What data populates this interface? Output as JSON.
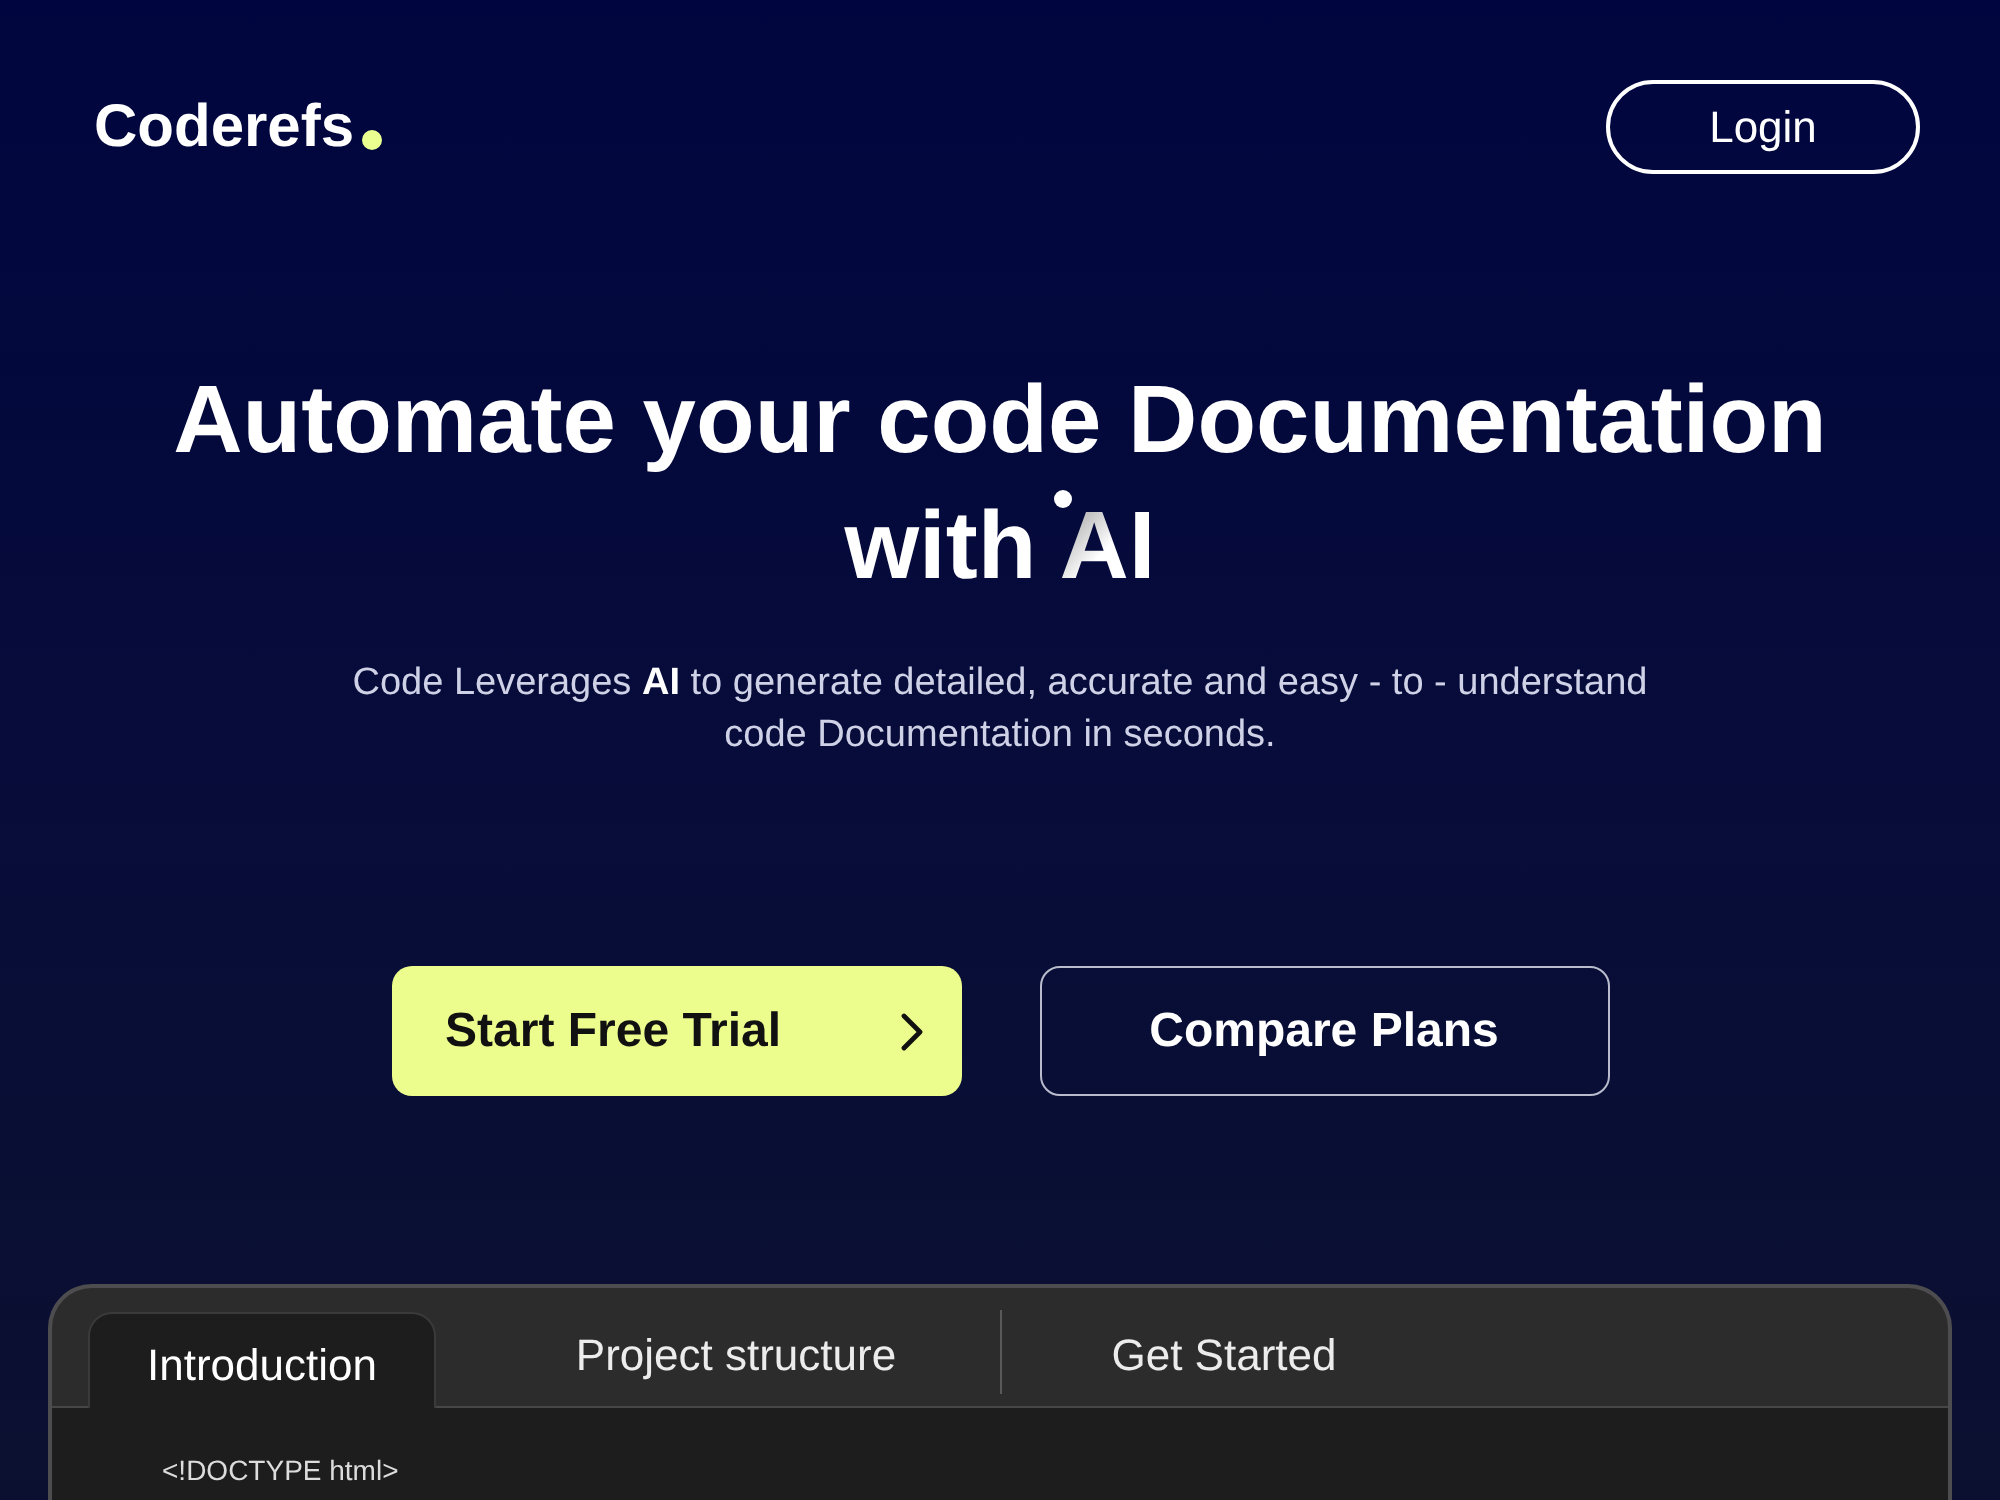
{
  "header": {
    "logo": "Coderefs",
    "login_button": "Login"
  },
  "hero": {
    "heading": "Automate your code Documentation with",
    "heading_highlight": "AI",
    "subtitle": "Code Leverages **AI** to generate detailed, accurate and easy - to - understand code Documentation in seconds."
  },
  "actions": [
    {
      "label": "Start Free Trial",
      "kind": "primary"
    },
    {
      "label": "Compare Plans",
      "kind": "secondary"
    }
  ],
  "code_panel": {
    "tabs": [
      {
        "label": "Introduction",
        "selected": true
      },
      {
        "label": "Project structure",
        "selected": false
      },
      {
        "label": "Get Started",
        "selected": false
      }
    ],
    "code_lines": [
      "<!DOCTYPE html>"
    ]
  }
}
